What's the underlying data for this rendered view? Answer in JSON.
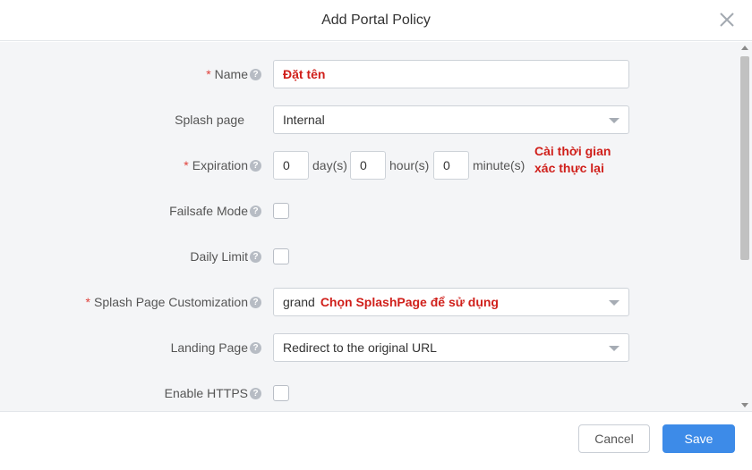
{
  "dialog": {
    "title": "Add Portal Policy",
    "close_icon": "close-icon"
  },
  "form": {
    "required_mark": "*",
    "help_glyph": "?",
    "name": {
      "label": "Name",
      "value": "Đặt tên"
    },
    "splash_page": {
      "label": "Splash page",
      "value": "Internal"
    },
    "expiration": {
      "label": "Expiration",
      "days": "0",
      "days_unit": "day(s)",
      "hours": "0",
      "hours_unit": "hour(s)",
      "minutes": "0",
      "minutes_unit": "minute(s)",
      "note_line1": "Cài thời gian",
      "note_line2": "xác thực lại"
    },
    "failsafe_mode": {
      "label": "Failsafe Mode",
      "checked": false
    },
    "daily_limit": {
      "label": "Daily Limit",
      "checked": false
    },
    "splash_page_customization": {
      "label": "Splash Page Customization",
      "value": "grand",
      "note": "Chọn SplashPage để sử dụng"
    },
    "landing_page": {
      "label": "Landing Page",
      "value": "Redirect to the original URL"
    },
    "enable_https": {
      "label": "Enable HTTPS",
      "checked": false
    }
  },
  "footer": {
    "cancel_label": "Cancel",
    "save_label": "Save"
  },
  "colors": {
    "accent": "#3d8be8",
    "required": "#e0413b",
    "annotation": "#d0201b",
    "panel_bg": "#f4f5f7"
  }
}
